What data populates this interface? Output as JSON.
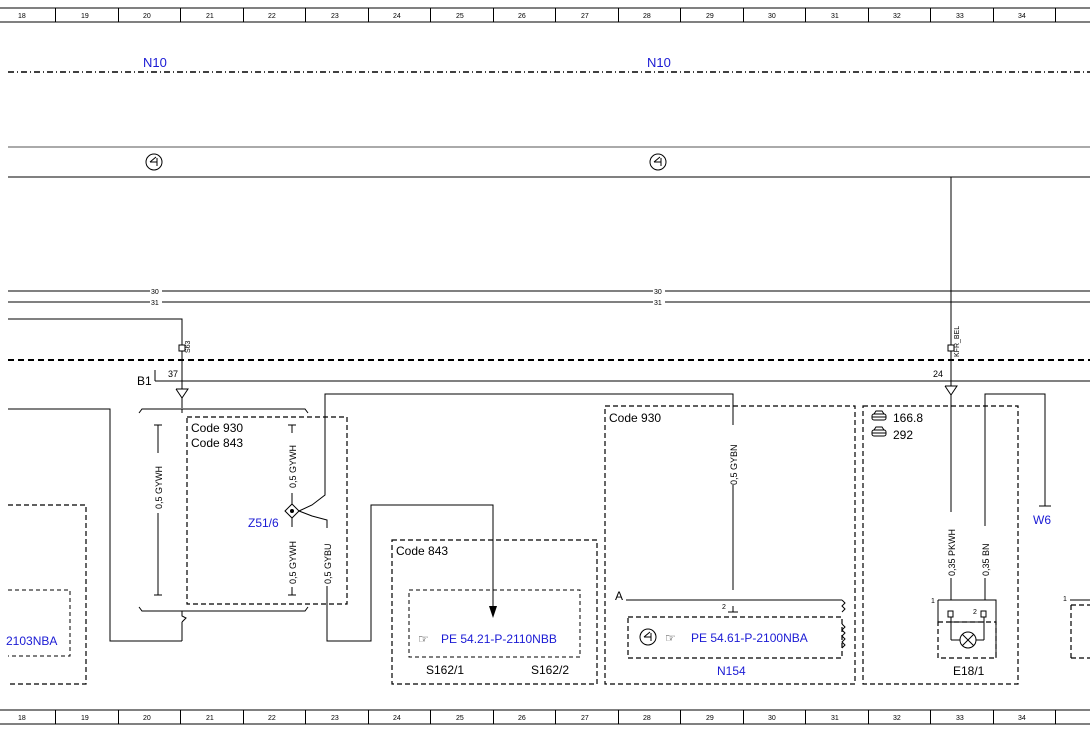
{
  "grid_columns": [
    "18",
    "19",
    "20",
    "21",
    "22",
    "23",
    "24",
    "25",
    "26",
    "27",
    "28",
    "29",
    "30",
    "31",
    "32",
    "33",
    "34"
  ],
  "bus_labels": {
    "n10_left": "N10",
    "n10_right": "N10"
  },
  "line_numbers": {
    "l30_left": "30",
    "l31_left": "31",
    "l30_right": "30",
    "l31_right": "31"
  },
  "connectors": {
    "b1": "B1",
    "pin_37": "37",
    "pin_24": "24",
    "s63": "S63",
    "kfr_bel": "KFR_BEL",
    "z51_6": "Z51/6",
    "w6": "W6",
    "pin_a": "A",
    "pin_2_n154": "2",
    "pin_1_e18": "1",
    "pin_2_e18": "2",
    "pin_1_right": "1"
  },
  "codes": {
    "code_930_left": "Code 930",
    "code_843_left": "Code 843",
    "code_843_mid": "Code 843",
    "code_930_right": "Code 930"
  },
  "car_refs": {
    "ref_1": "166.8",
    "ref_2": "292"
  },
  "wires": {
    "gywh_left": "0,5 GYWH",
    "gywh_top": "0,5 GYWH",
    "gywh_bottom": "0,5 GYWH",
    "gybu": "0,5 GYBU",
    "gybn": "0,5 GYBN",
    "pkwh": "0,35 PKWH",
    "bn": "0,35 BN"
  },
  "references": {
    "left_partial": "2103NBA",
    "pe_2110": "PE 54.21-P-2110NBB",
    "pe_2100": "PE 54.61-P-2100NBA"
  },
  "components": {
    "s162_1": "S162/1",
    "s162_2": "S162/2",
    "n154": "N154",
    "e18_1": "E18/1"
  },
  "colors": {
    "link_blue": "#1a1ad4",
    "line": "#000000"
  }
}
